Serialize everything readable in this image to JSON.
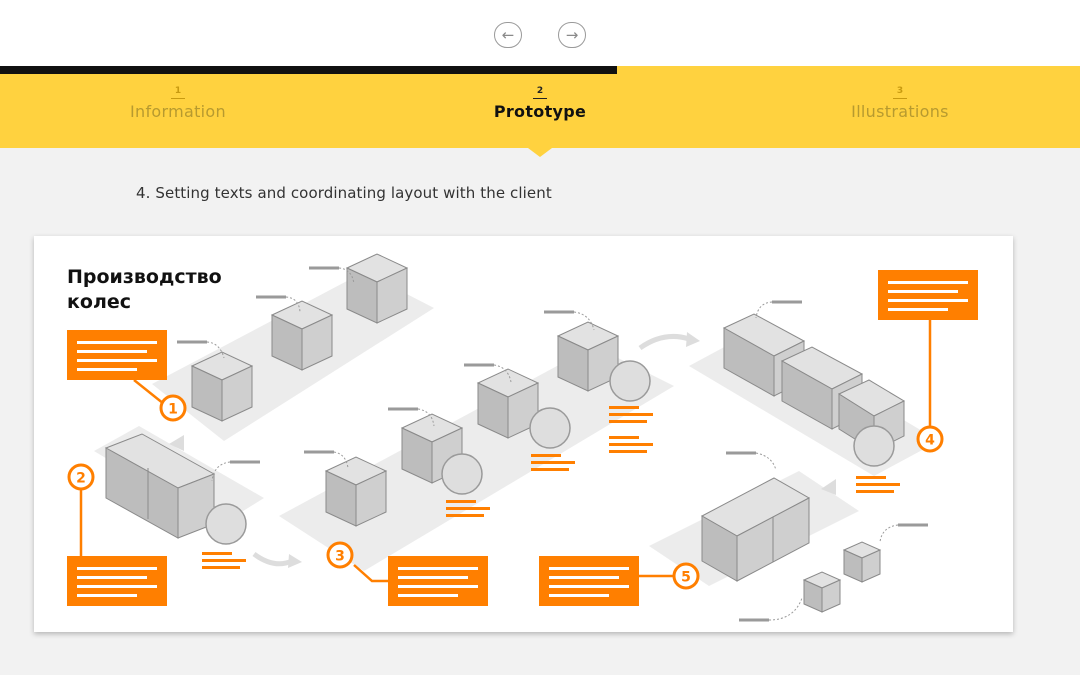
{
  "navigation": {
    "prev_icon": "←",
    "next_icon": "→",
    "progress": 0.571
  },
  "steps": [
    {
      "number": "1",
      "label": "Information"
    },
    {
      "number": "2",
      "label": "Prototype"
    },
    {
      "number": "3",
      "label": "Illustrations"
    }
  ],
  "active_step": 2,
  "caption": "4. Setting texts and coordinating layout with the client",
  "illustration": {
    "title_line1": "Производство",
    "title_line2": "колес",
    "markers": [
      "1",
      "2",
      "3",
      "4",
      "5"
    ],
    "colors": {
      "accent": "#ff7f00",
      "box": "#c8c8c8",
      "platform": "#ececec"
    }
  }
}
